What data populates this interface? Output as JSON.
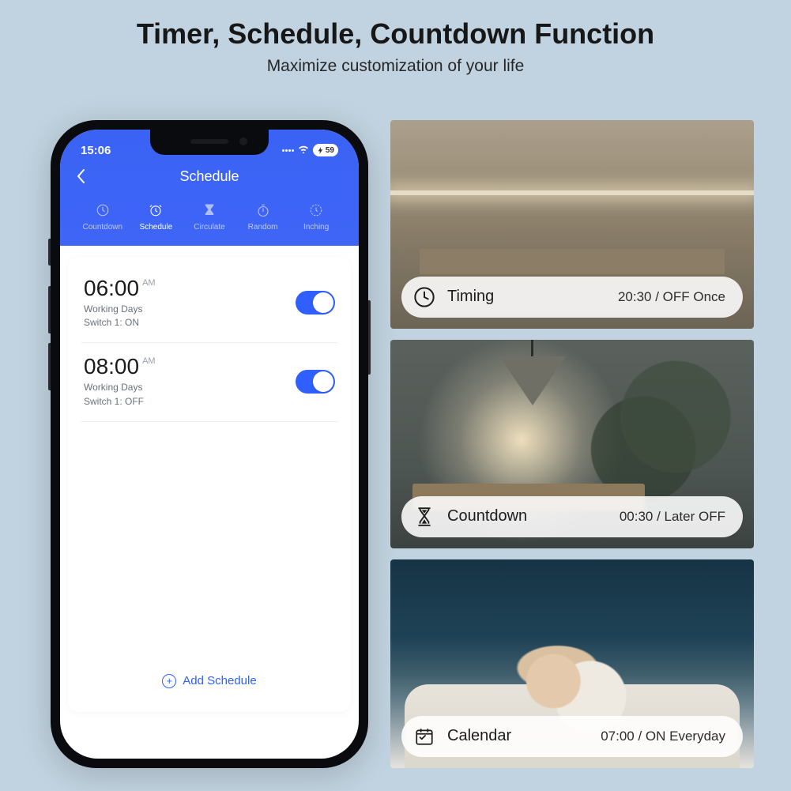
{
  "headline": "Timer, Schedule, Countdown Function",
  "subhead": "Maximize customization of your life",
  "phone": {
    "status": {
      "time": "15:06",
      "battery": "59"
    },
    "nav_title": "Schedule",
    "tabs": [
      {
        "label": "Countdown"
      },
      {
        "label": "Schedule"
      },
      {
        "label": "Circulate"
      },
      {
        "label": "Random"
      },
      {
        "label": "Inching"
      }
    ],
    "schedules": [
      {
        "time": "06:00",
        "ampm": "AM",
        "days": "Working Days",
        "action": "Switch 1: ON"
      },
      {
        "time": "08:00",
        "ampm": "AM",
        "days": "Working Days",
        "action": "Switch 1: OFF"
      }
    ],
    "add_label": "Add Schedule"
  },
  "scenes": [
    {
      "title": "Timing",
      "value": "20:30 / OFF Once"
    },
    {
      "title": "Countdown",
      "value": "00:30 / Later OFF"
    },
    {
      "title": "Calendar",
      "value": "07:00 / ON Everyday"
    }
  ]
}
